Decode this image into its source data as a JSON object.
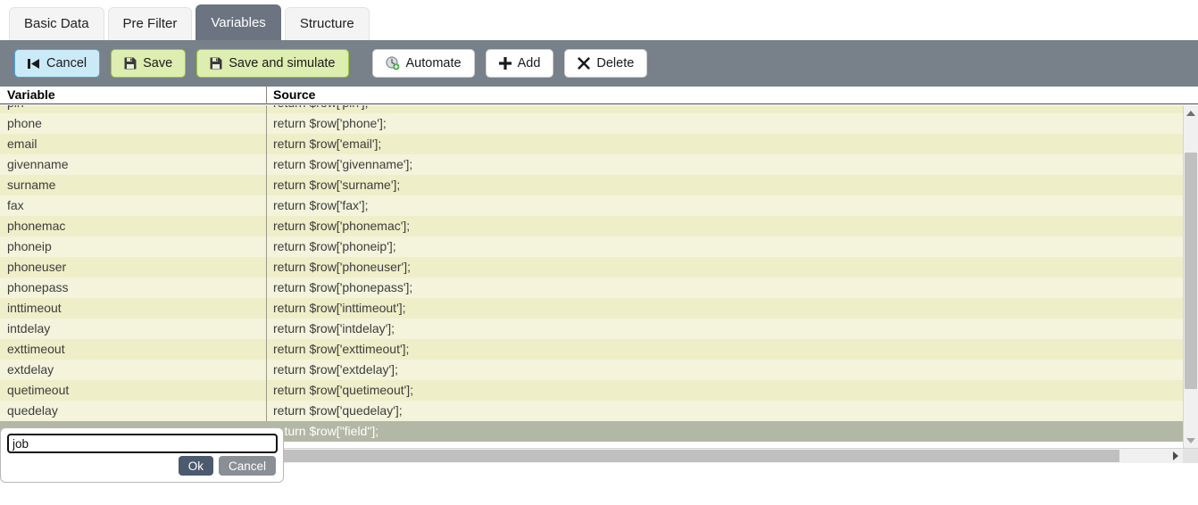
{
  "tabs": [
    {
      "label": "Basic Data",
      "active": false
    },
    {
      "label": "Pre Filter",
      "active": false
    },
    {
      "label": "Variables",
      "active": true
    },
    {
      "label": "Structure",
      "active": false
    }
  ],
  "toolbar": {
    "cancel_label": "Cancel",
    "save_label": "Save",
    "save_simulate_label": "Save and simulate",
    "automate_label": "Automate",
    "add_label": "Add",
    "delete_label": "Delete"
  },
  "table": {
    "columns": [
      "Variable",
      "Source"
    ],
    "rows": [
      {
        "variable": "pin",
        "source": "return $row['pin'];",
        "selected": false
      },
      {
        "variable": "phone",
        "source": "return $row['phone'];",
        "selected": false
      },
      {
        "variable": "email",
        "source": "return $row['email'];",
        "selected": false
      },
      {
        "variable": "givenname",
        "source": "return $row['givenname'];",
        "selected": false
      },
      {
        "variable": "surname",
        "source": "return $row['surname'];",
        "selected": false
      },
      {
        "variable": "fax",
        "source": "return $row['fax'];",
        "selected": false
      },
      {
        "variable": "phonemac",
        "source": "return $row['phonemac'];",
        "selected": false
      },
      {
        "variable": "phoneip",
        "source": "return $row['phoneip'];",
        "selected": false
      },
      {
        "variable": "phoneuser",
        "source": "return $row['phoneuser'];",
        "selected": false
      },
      {
        "variable": "phonepass",
        "source": "return $row['phonepass'];",
        "selected": false
      },
      {
        "variable": "inttimeout",
        "source": "return $row['inttimeout'];",
        "selected": false
      },
      {
        "variable": "intdelay",
        "source": "return $row['intdelay'];",
        "selected": false
      },
      {
        "variable": "exttimeout",
        "source": "return $row['exttimeout'];",
        "selected": false
      },
      {
        "variable": "extdelay",
        "source": "return $row['extdelay'];",
        "selected": false
      },
      {
        "variable": "quetimeout",
        "source": "return $row['quetimeout'];",
        "selected": false
      },
      {
        "variable": "quedelay",
        "source": "return $row['quedelay'];",
        "selected": false
      },
      {
        "variable": "",
        "source": "return $row[\"field\"];",
        "selected": true
      }
    ]
  },
  "edit_popup": {
    "value": "job",
    "ok_label": "Ok",
    "cancel_label": "Cancel"
  },
  "colors": {
    "toolbar_bg": "#78808a",
    "active_tab_bg": "#6b7480",
    "row_odd": "#eeeec8",
    "row_even": "#f4f4dc",
    "row_selected": "#b3b7a5",
    "cancel_button": "#cbeaf8",
    "save_button": "#ddeeb0",
    "ok_button": "#4c5a6e"
  }
}
